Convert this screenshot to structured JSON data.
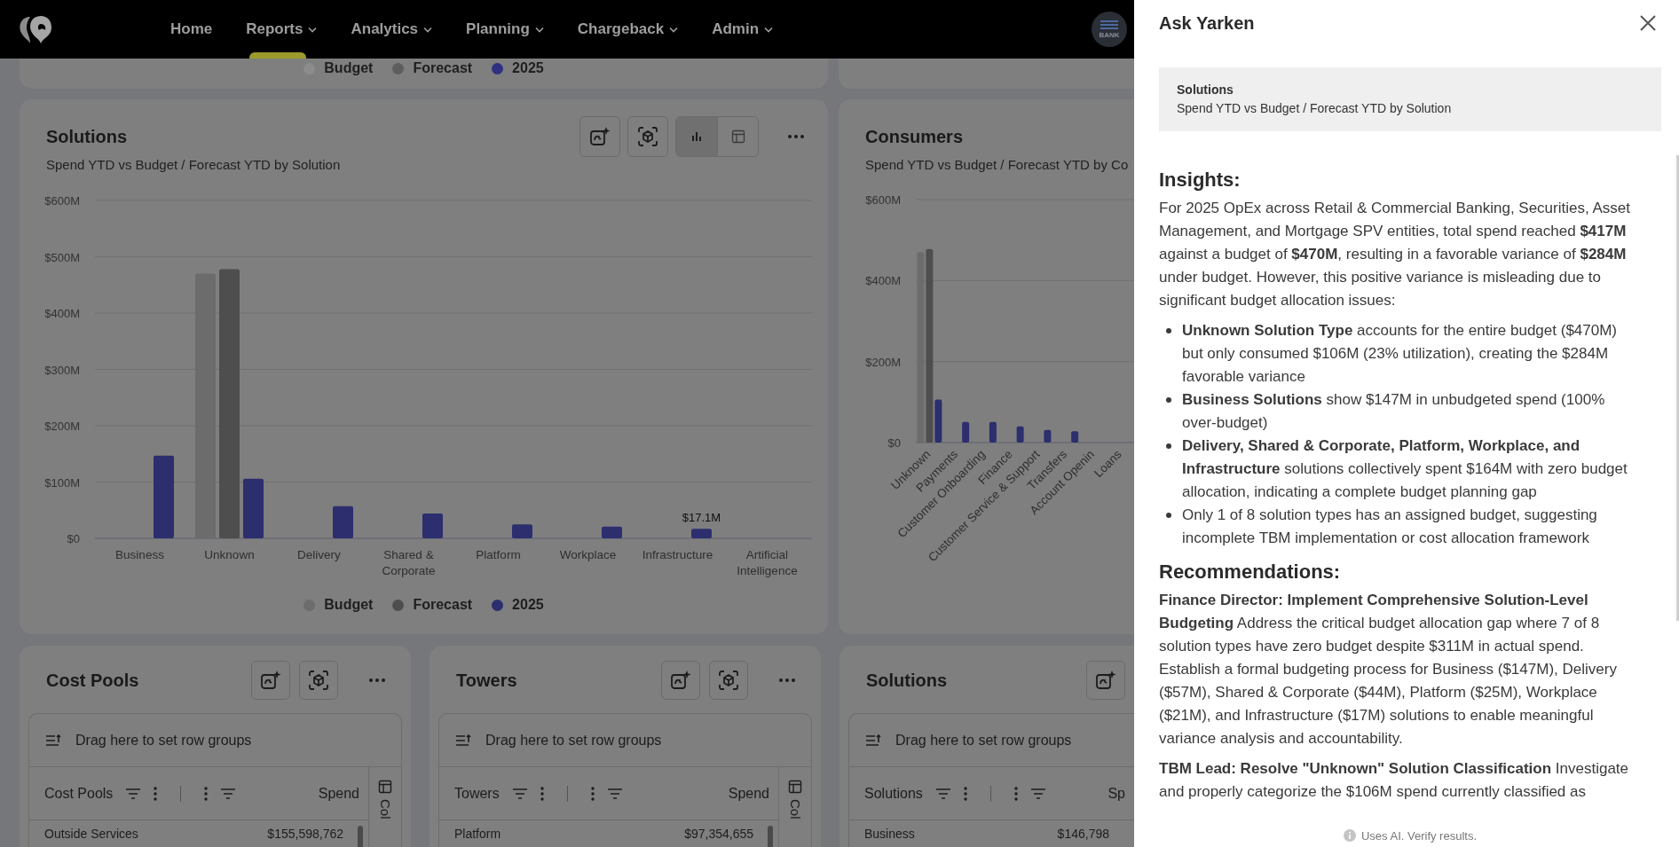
{
  "nav": {
    "items": [
      {
        "label": "Home",
        "dropdown": false,
        "selected": false
      },
      {
        "label": "Reports",
        "dropdown": true,
        "selected": true
      },
      {
        "label": "Analytics",
        "dropdown": true,
        "selected": false
      },
      {
        "label": "Planning",
        "dropdown": true,
        "selected": false
      },
      {
        "label": "Chargeback",
        "dropdown": true,
        "selected": false
      },
      {
        "label": "Admin",
        "dropdown": true,
        "selected": false
      }
    ],
    "avatar_label": "BANK"
  },
  "top_legend": [
    {
      "label": "Budget",
      "color": "#8c8c8c"
    },
    {
      "label": "Forecast",
      "color": "#5e5e5e"
    },
    {
      "label": "2025",
      "color": "#2e3080"
    }
  ],
  "charts": [
    {
      "title": "Solutions",
      "subtitle": "Spend YTD vs Budget / Forecast YTD by Solution",
      "toolbar": {
        "view_toggle": [
          {
            "kind": "chart",
            "selected": true
          },
          {
            "kind": "table",
            "selected": false
          }
        ]
      },
      "chart_data": {
        "type": "bar",
        "categories": [
          "Business",
          "Unknown",
          "Delivery",
          "Shared & Corporate",
          "Platform",
          "Workplace",
          "Infrastructure",
          "Artificial Intelligence"
        ],
        "series": [
          {
            "name": "Budget",
            "color": "#6c6c6c",
            "values": [
              0,
              470,
              0,
              0,
              0,
              0,
              0,
              0
            ]
          },
          {
            "name": "Forecast",
            "color": "#4e4e4e",
            "values": [
              0,
              478,
              0,
              0,
              0,
              0,
              0,
              0
            ]
          },
          {
            "name": "2025",
            "color": "#2c2e6e",
            "values": [
              147,
              106,
              57,
              44,
              25,
              21,
              17,
              0
            ]
          }
        ],
        "grid": true,
        "ylim": [
          0,
          600
        ],
        "yticks": [
          {
            "value": 0,
            "label": "$0"
          },
          {
            "value": 100,
            "label": "$100M"
          },
          {
            "value": 200,
            "label": "$200M"
          },
          {
            "value": 300,
            "label": "$300M"
          },
          {
            "value": 400,
            "label": "$400M"
          },
          {
            "value": 500,
            "label": "$500M"
          },
          {
            "value": 600,
            "label": "$600M"
          }
        ],
        "annotations": [
          "$17.1M"
        ]
      }
    },
    {
      "title": "Consumers",
      "subtitle": "Spend YTD vs Budget / Forecast YTD by Co",
      "chart_data": {
        "type": "bar",
        "categories": [
          "Unknown",
          "Payments",
          "Customer Onboarding",
          "Finance",
          "Customer Service & Support",
          "Transfers",
          "Account Openin",
          "Loans"
        ],
        "series": [
          {
            "color": "#6c6c6c",
            "values": [
              470,
              0,
              0,
              0,
              0,
              0,
              null,
              null
            ]
          },
          {
            "color": "#4e4e4e",
            "values": [
              478,
              0,
              0,
              0,
              0,
              0,
              null,
              null
            ]
          },
          {
            "color": "#2c2e6e",
            "values": [
              106,
              51,
              51,
              40,
              31,
              28,
              null,
              null
            ]
          }
        ],
        "grid": true,
        "ylim": [
          0,
          600
        ],
        "yticks": [
          {
            "value": 0,
            "label": "$0"
          },
          {
            "value": 200,
            "label": "$200M"
          },
          {
            "value": 400,
            "label": "$400M"
          },
          {
            "value": 600,
            "label": "$600M"
          }
        ]
      }
    }
  ],
  "tables": [
    {
      "title": "Cost Pools",
      "tools": [
        {
          "kind": "ai"
        },
        {
          "kind": "cube"
        },
        {
          "kind": "more"
        }
      ],
      "group_hint": "Drag here to set row groups",
      "columns": [
        "Cost Pools",
        "Spend"
      ],
      "side_label": "Col",
      "rows": [
        [
          "Outside Services",
          "$155,598,762"
        ]
      ]
    },
    {
      "title": "Towers",
      "tools": [
        {
          "kind": "ai"
        },
        {
          "kind": "cube"
        },
        {
          "kind": "more"
        }
      ],
      "group_hint": "Drag here to set row groups",
      "columns": [
        "Towers",
        "Spend"
      ],
      "side_label": "Col",
      "rows": [
        [
          "Platform",
          "$97,354,655"
        ]
      ]
    },
    {
      "title": "Solutions",
      "tools": [
        {
          "kind": "ai"
        }
      ],
      "group_hint": "Drag here to set row groups",
      "columns": [
        "Solutions",
        "Sp"
      ],
      "rows": [
        [
          "Business",
          "$146,798"
        ]
      ]
    }
  ],
  "panel": {
    "title": "Ask Yarken",
    "context": {
      "title": "Solutions",
      "subtitle": "Spend YTD vs Budget / Forecast YTD by Solution"
    },
    "sections": [
      {
        "heading": "Insights:",
        "blocks": [
          {
            "kind": "paragraph",
            "text": "For 2025 OpEx across Retail & Commercial Banking, Securities, Asset Management, and Mortgage SPV entities, total spend reached **$417M** against a budget of **$470M**, resulting in a favorable variance of **$284M** under budget. However, this positive variance is misleading due to significant budget allocation issues:"
          },
          {
            "kind": "bullets",
            "items": [
              "**Unknown Solution Type** accounts for the entire budget ($470M) but only consumed $106M (23% utilization), creating the $284M favorable variance",
              "**Business Solutions** show $147M in unbudgeted spend (100% over-budget)",
              "**Delivery, Shared & Corporate, Platform, Workplace, and Infrastructure** solutions collectively spent $164M with zero budget allocation, indicating a complete budget planning gap",
              "Only 1 of 8 solution types has an assigned budget, suggesting incomplete TBM implementation or cost allocation framework"
            ]
          }
        ]
      },
      {
        "heading": "Recommendations:",
        "blocks": [
          {
            "kind": "paragraph",
            "text": "**Finance Director: Implement Comprehensive Solution-Level Budgeting** Address the critical budget allocation gap where 7 of 8 solution types have zero budget despite $311M in actual spend. Establish a formal budgeting process for Business ($147M), Delivery ($57M), Shared & Corporate ($44M), Platform ($25M), Workplace ($21M), and Infrastructure ($17M) solutions to enable meaningful variance analysis and accountability."
          },
          {
            "kind": "paragraph",
            "text": "**TBM Lead: Resolve \"Unknown\" Solution Classification** Investigate and properly categorize the $106M spend currently classified as"
          }
        ]
      }
    ],
    "footer": "Uses AI. Verify results."
  }
}
